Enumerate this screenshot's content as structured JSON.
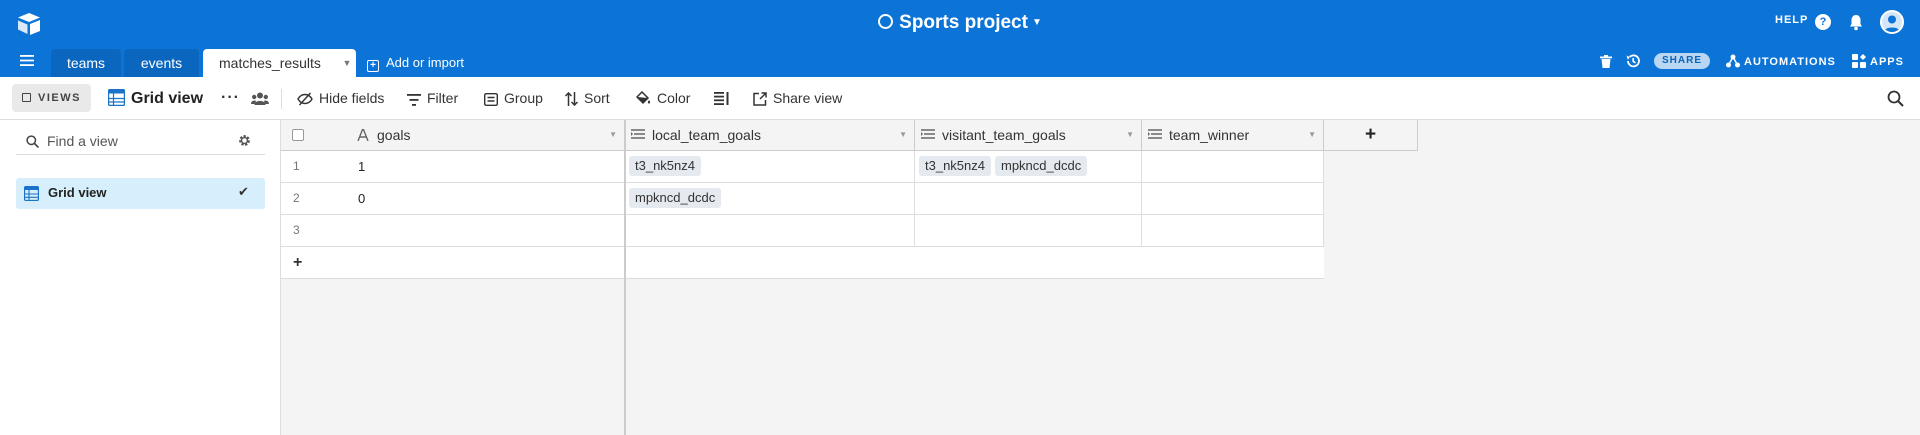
{
  "header": {
    "project_title": "Sports project",
    "help_label": "HELP",
    "share_label": "SHARE",
    "automations_label": "AUTOMATIONS",
    "apps_label": "APPS",
    "accent_color": "#0b74d6"
  },
  "tabs": [
    {
      "label": "teams",
      "active": false
    },
    {
      "label": "events",
      "active": false
    },
    {
      "label": "matches_results",
      "active": true
    }
  ],
  "add_import_label": "Add or import",
  "toolbar": {
    "views_label": "VIEWS",
    "view_name": "Grid view",
    "hide_fields": "Hide fields",
    "filter": "Filter",
    "group": "Group",
    "sort": "Sort",
    "color": "Color",
    "share_view": "Share view"
  },
  "sidebar": {
    "search_placeholder": "Find a view",
    "views": [
      {
        "label": "Grid view",
        "selected": true
      }
    ]
  },
  "grid": {
    "columns": [
      {
        "name": "goals",
        "icon": "text-icon"
      },
      {
        "name": "local_team_goals",
        "icon": "lookup-icon"
      },
      {
        "name": "visitant_team_goals",
        "icon": "lookup-icon"
      },
      {
        "name": "team_winner",
        "icon": "lookup-icon"
      }
    ],
    "rows": [
      {
        "n": "1",
        "goals": "1",
        "local": [
          "t3_nk5nz4"
        ],
        "visitant": [
          "t3_nk5nz4",
          "mpkncd_dcdc"
        ],
        "winner": []
      },
      {
        "n": "2",
        "goals": "0",
        "local": [
          "mpkncd_dcdc"
        ],
        "visitant": [],
        "winner": []
      },
      {
        "n": "3",
        "goals": "",
        "local": [],
        "visitant": [],
        "winner": []
      }
    ],
    "add_row": "+",
    "add_column": "+"
  }
}
